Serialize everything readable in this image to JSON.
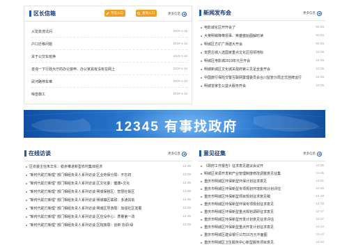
{
  "district": {
    "title": "区长信箱",
    "btn_write": "写信入口",
    "btn_search": "查询入口",
    "more": "更多信息",
    "rows": [
      {
        "text": "火龙泉洗坑问",
        "date": "2019-1-15"
      },
      {
        "text": "户口迁移问题",
        "date": "2019-1-10"
      },
      {
        "text": "关于公交车班换",
        "date": "2019-1-10"
      },
      {
        "text": "咨询一下行政大厅的办公窗申、办公家具有没有在网上",
        "date": "2019-1-10"
      },
      {
        "text": "武河路停车难",
        "date": "2019-1-10"
      },
      {
        "text": "噪音施工",
        "date": "2019-1-10"
      }
    ]
  },
  "news": {
    "title": "新闻发布会",
    "more": "更多信息",
    "rows": [
      {
        "text": "电影城化区开开会了",
        "date": "01-03"
      },
      {
        "text": "大英明锡降带领事、英雄盛始图解时读",
        "date": "01-03"
      },
      {
        "text": "明城区方扩广场建大开会",
        "date": "01-03"
      },
      {
        "text": "安居古城入选国家重点文化区招领地标",
        "date": "12-28"
      },
      {
        "text": "明城区电影城2019年元旦开会",
        "date": "12-26"
      },
      {
        "text": "明城新城区文化城关政府第三见足全金开会",
        "date": "12-26"
      },
      {
        "text": "中国旅行保险交警互联网置理委员会合川监管分局正式挂牌运行",
        "date": "12-25"
      },
      {
        "text": "明城曾家生公益大服务开会",
        "date": "12-25"
      }
    ]
  },
  "banner": {
    "title": "12345 有事找政府"
  },
  "online": {
    "title": "在线访谈",
    "more": "更多信息",
    "rows": [
      {
        "text": "区农委主任朱华东：稳步推进新型农村集体经济",
        "date": "12-28"
      },
      {
        "text": "\"新时代助力新理\" 部门相组负责人系列访谈 区业劳保分局：不忘初",
        "date": "12-28"
      },
      {
        "text": "\"新时代助力新理\" 部门相组负责人系列访谈 区文化委：健康+文化",
        "date": "12-28"
      },
      {
        "text": "\"新时代助力新理\" 部门相组负责人系列访谈 明城保税区：智慧社街区",
        "date": "12-26"
      },
      {
        "text": "\"新时代助力新理\" 部门相组负责人系列访谈 明城镇区联政：多通扶贫",
        "date": "12-26"
      },
      {
        "text": "\"新时代助力新理\" 部门相组负责人系列访谈 明城区导游局：加强社区发展",
        "date": "12-25"
      },
      {
        "text": "\"新时代助力新理\" 部门相组负责人系列访谈 区应没中心：质量第一改",
        "date": "12-25"
      },
      {
        "text": "\"新时代助力新理\" 部门相组负责人系列访谈 区院旅局：创新 协调 绿",
        "date": "12-25"
      }
    ]
  },
  "opinion": {
    "title": "意见征集",
    "more": "更多信息",
    "rows": [
      {
        "text": "《政府工作报告》征求意见建议会议开",
        "date": "12-26"
      },
      {
        "text": "明城区资源开发和产业管理制度修改调整意见征集",
        "date": "12-25"
      },
      {
        "text": "重庆市明城区环保新型环保计划征求意见",
        "date": "12-21"
      },
      {
        "text": "重庆市明城区环保新型专项规划环境影响计划评估",
        "date": "12-20"
      },
      {
        "text": "重庆市明城区环保新型项目规划征求意见稿",
        "date": "12-19"
      },
      {
        "text": "重庆市明城区环保新型环保专项规划征求意见",
        "date": "12-18"
      },
      {
        "text": "重庆市明城区环保新型重点规划调研征求意见",
        "date": "12-17"
      },
      {
        "text": "重庆市明城区环保新型开发计划意见征求评估",
        "date": "12-17"
      },
      {
        "text": "重庆市明城区环保新型重点开发计划征求意见",
        "date": "12-14"
      },
      {
        "text": "重庆市明城区建设银行公司10万元平面图",
        "date": "12-12"
      },
      {
        "text": "重庆市明城区卫生服务中心新型服务项目意见",
        "date": "12-10"
      }
    ]
  },
  "colors": {
    "accent": "#1b5fb0",
    "orange": "#f0a020",
    "title": "#1a3d73"
  },
  "icons": {
    "write": "pencil-icon",
    "search": "search-icon",
    "more": "arrow-right-icon"
  }
}
